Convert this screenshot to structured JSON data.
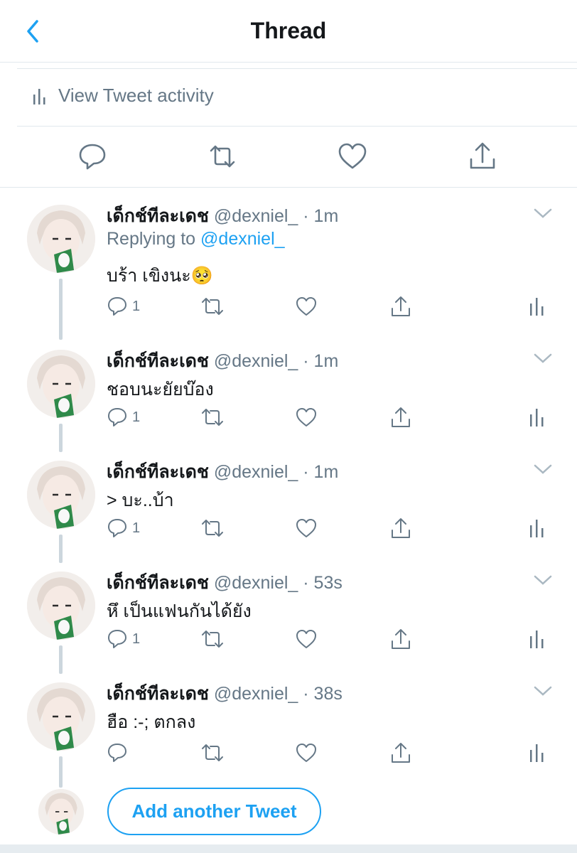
{
  "header": {
    "title": "Thread"
  },
  "activity": {
    "label": "View Tweet activity"
  },
  "colors": {
    "accent": "#1da1f2",
    "secondary_text": "#657786",
    "divider": "#e1e8ed",
    "thread_line": "#ccd6dd"
  },
  "tweets": [
    {
      "name": "เด็กช์ทีละเดช",
      "meta": "@dexniel_ · 1m",
      "replying_prefix": "Replying to ",
      "replying_to": "@dexniel_",
      "text": "บร้า เขิงนะ🥺",
      "reply_count": "1"
    },
    {
      "name": "เด็กช์ทีละเดช",
      "meta": "@dexniel_ · 1m",
      "text": "ชอบนะยัยบ๊อง",
      "reply_count": "1"
    },
    {
      "name": "เด็กช์ทีละเดช",
      "meta": "@dexniel_ · 1m",
      "text": "> บะ..บ้า",
      "reply_count": "1"
    },
    {
      "name": "เด็กช์ทีละเดช",
      "meta": "@dexniel_ · 53s",
      "text": "หึ เป็นแฟนกันได้ยัง",
      "reply_count": "1"
    },
    {
      "name": "เด็กช์ทีละเดช",
      "meta": "@dexniel_ · 38s",
      "text": "ฮือ :-; ตกลง",
      "reply_count": ""
    }
  ],
  "compose": {
    "button_label": "Add another Tweet"
  }
}
